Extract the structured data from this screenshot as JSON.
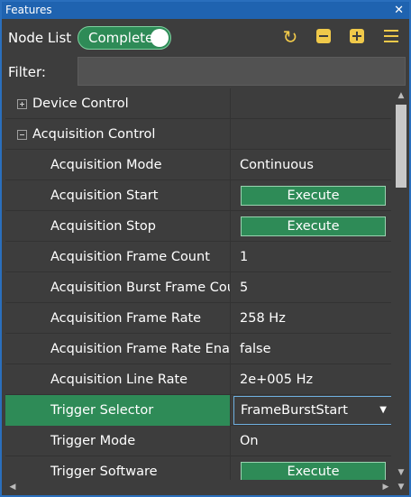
{
  "window": {
    "title": "Features",
    "close_glyph": "✕"
  },
  "toolbar": {
    "node_list_label": "Node List",
    "visibility_toggle_label": "Complete",
    "refresh_glyph": "↻"
  },
  "filter": {
    "label": "Filter:",
    "value": "",
    "placeholder": ""
  },
  "tree": {
    "categories": [
      {
        "name": "Device Control",
        "expanded": false
      },
      {
        "name": "Acquisition Control",
        "expanded": true
      }
    ],
    "features": [
      {
        "name": "Acquisition Mode",
        "value": "Continuous",
        "type": "text"
      },
      {
        "name": "Acquisition Start",
        "value": "Execute",
        "type": "button"
      },
      {
        "name": "Acquisition Stop",
        "value": "Execute",
        "type": "button"
      },
      {
        "name": "Acquisition Frame Count",
        "value": "1",
        "type": "text"
      },
      {
        "name": "Acquisition Burst Frame Count",
        "value": "5",
        "type": "text"
      },
      {
        "name": "Acquisition Frame Rate",
        "value": "258 Hz",
        "type": "text"
      },
      {
        "name": "Acquisition Frame Rate Enable",
        "value": "false",
        "type": "text"
      },
      {
        "name": "Acquisition Line Rate",
        "value": "2e+005 Hz",
        "type": "text"
      },
      {
        "name": "Trigger Selector",
        "value": "FrameBurstStart",
        "type": "select",
        "arrow": "▼"
      },
      {
        "name": "Trigger Mode",
        "value": "On",
        "type": "text"
      },
      {
        "name": "Trigger Software",
        "value": "Execute",
        "type": "button"
      }
    ]
  },
  "scroll": {
    "up": "▲",
    "down": "▼",
    "left": "◀",
    "right": "▶"
  },
  "colors": {
    "panel_bg": "#3d3d3d",
    "accent_green": "#2e8b57",
    "title_blue": "#1f63b0",
    "icon_yellow": "#f0c94a"
  }
}
